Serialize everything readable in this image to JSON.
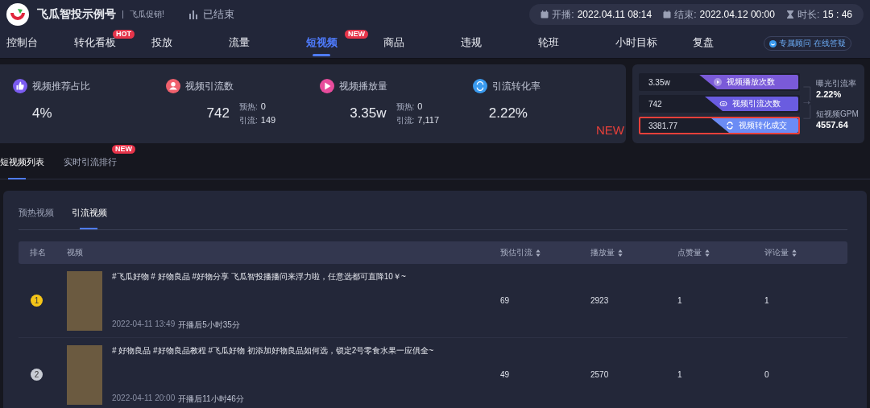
{
  "header": {
    "brand": "飞瓜智投示例号",
    "slogan": "飞瓜促销!",
    "status": "已结束",
    "times": [
      {
        "kind": "calendar",
        "label": "开播:",
        "value": "2022.04.11 08:14"
      },
      {
        "kind": "calendar",
        "label": "结束:",
        "value": "2022.04.12 00:00"
      },
      {
        "kind": "hourglass",
        "label": "时长:",
        "value": "15 : 46"
      }
    ]
  },
  "nav": {
    "tabs": [
      {
        "label": "控制台",
        "selected": false
      },
      {
        "label": "转化看板",
        "selected": false,
        "badge": "HOT"
      },
      {
        "label": "投放",
        "selected": false
      },
      {
        "label": "流量",
        "selected": false
      },
      {
        "label": "短视频",
        "selected": true,
        "badge": "NEW"
      },
      {
        "label": "商品",
        "selected": false
      },
      {
        "label": "违规",
        "selected": false
      },
      {
        "label": "轮班",
        "selected": false
      },
      {
        "label": "小时目标",
        "selected": false
      },
      {
        "label": "复盘",
        "selected": false
      }
    ],
    "consult": "专属顾问 在线答疑"
  },
  "stats": [
    {
      "kind": "thumb",
      "color": "#7b5cf0",
      "label": "视频推荐占比",
      "value": "4%"
    },
    {
      "kind": "person",
      "color": "#f0616d",
      "label": "视频引流数",
      "value": "742",
      "details": [
        {
          "label": "预热:",
          "value": "0"
        },
        {
          "label": "引流:",
          "value": "149"
        }
      ]
    },
    {
      "kind": "play",
      "color": "#e84c9c",
      "label": "视频播放量",
      "value": "3.35w",
      "details": [
        {
          "label": "预热:",
          "value": "0"
        },
        {
          "label": "引流:",
          "value": "7,117"
        }
      ]
    },
    {
      "kind": "convert",
      "color": "#3a9bf0",
      "label": "引流转化率",
      "value": "2.22%"
    }
  ],
  "annotation": "NEW",
  "funnel": {
    "rows": [
      {
        "kind": "play",
        "value": "3.35w",
        "label": "视频播放次数",
        "color": "#7a5ad8",
        "highlighted": false
      },
      {
        "kind": "link",
        "value": "742",
        "label": "视频引流次数",
        "color": "#6a5ce0",
        "highlighted": false
      },
      {
        "kind": "convert",
        "value": "3381.77",
        "label": "视频转化成交",
        "color": "#6b8cf5",
        "highlighted": true
      }
    ],
    "rates": [
      {
        "label": "曝光引流率",
        "value": "2.22%"
      },
      {
        "label": "短视频GPM",
        "value": "4557.64"
      }
    ]
  },
  "section_tabs": [
    {
      "label": "短视频列表",
      "selected": true
    },
    {
      "label": "实时引流排行",
      "selected": false,
      "badge": "NEW"
    }
  ],
  "sub_tabs": [
    {
      "label": "预热视频",
      "selected": false
    },
    {
      "label": "引流视频",
      "selected": true
    }
  ],
  "table": {
    "columns": [
      {
        "label": "排名",
        "sortable": false
      },
      {
        "label": "视频",
        "sortable": false
      },
      {
        "label": "预估引流",
        "sortable": true
      },
      {
        "label": "播放量",
        "sortable": true
      },
      {
        "label": "点赞量",
        "sortable": true
      },
      {
        "label": "评论量",
        "sortable": true
      }
    ],
    "rows": [
      {
        "rank": "1",
        "color": "#f5c518",
        "title": "#飞瓜好物 # 好物良品 #好物分享 飞瓜智投播播问来浮力啦，任意选都可直降10￥~",
        "time": "2022-04-11 13:49",
        "after": "开播后5小时35分",
        "metrics": [
          "69",
          "2923",
          "1",
          "1"
        ]
      },
      {
        "rank": "2",
        "color": "#c8ccd4",
        "title": "# 好物良品 #好物良品教程 #飞瓜好物 初添加好物良品如何选，锁定2号零食水果一应俱全~",
        "time": "2022-04-11 20:00",
        "after": "开播后11小时46分",
        "metrics": [
          "49",
          "2570",
          "1",
          "0"
        ]
      }
    ]
  }
}
